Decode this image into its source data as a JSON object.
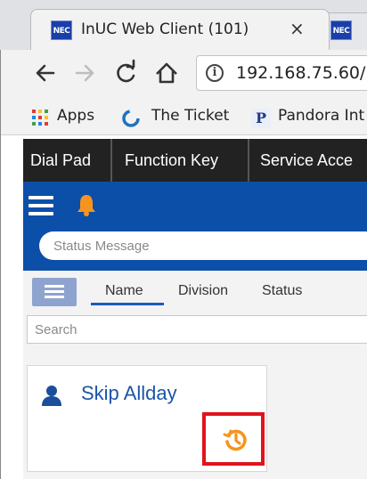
{
  "browser": {
    "active_tab": {
      "favicon_text": "NEC",
      "title": "InUC Web Client (101)",
      "close_glyph": "×"
    },
    "second_tab": {
      "favicon_text": "NEC"
    },
    "url": "192.168.75.60/",
    "bookmarks": [
      {
        "label": "Apps",
        "icon": "apps-grid-icon"
      },
      {
        "label": "The Ticket",
        "icon": "ticket-icon"
      },
      {
        "label": "Pandora Int",
        "icon": "p-icon",
        "icon_text": "P"
      }
    ]
  },
  "app": {
    "nav": [
      "Dial Pad",
      "Function Key",
      "Service Acce"
    ],
    "status_message": {
      "placeholder": "Status Message",
      "value": ""
    },
    "directory_tabs": [
      "Name",
      "Division",
      "Status"
    ],
    "active_directory_tab": "Name",
    "search": {
      "placeholder": "Search",
      "value": ""
    },
    "contact": {
      "name": "Skip Allday",
      "icon": "person-icon",
      "action_icon": "call-history-icon"
    }
  },
  "colors": {
    "header_blue": "#0c4fa8",
    "nav_dark": "#222222",
    "bell_orange": "#f7941d",
    "highlight_red": "#e0131d",
    "name_blue": "#1b55a8"
  }
}
